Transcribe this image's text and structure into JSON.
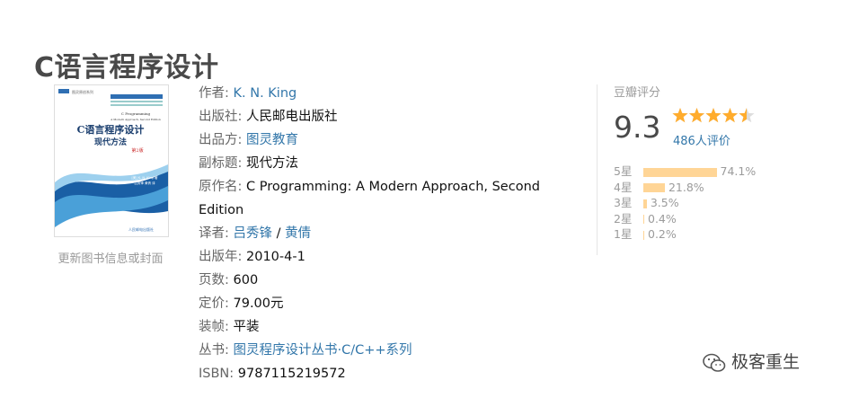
{
  "book": {
    "title": "C语言程序设计"
  },
  "cover": {
    "update_link": "更新图书信息或封面",
    "series_badge": "图灵原创系列",
    "title_cn": "C语言程序设计",
    "subtitle_cn": "现代方法",
    "edition": "第2版",
    "title_en_1": "C Programming",
    "title_en_2": "A Modern Approach, Second Edition",
    "author": "[美] K. N. King 著",
    "translators": "吕秀锋 黄倩 译",
    "publisher": "人民邮电出版社"
  },
  "info": [
    {
      "label": "作者:",
      "value": "K. N. King",
      "link": true
    },
    {
      "label": "出版社:",
      "value": "人民邮电出版社",
      "link": false
    },
    {
      "label": "出品方:",
      "value": "图灵教育",
      "link": true
    },
    {
      "label": "副标题:",
      "value": "现代方法",
      "link": false
    },
    {
      "label": "原作名:",
      "value": "C Programming: A Modern Approach, Second Edition",
      "link": false
    },
    {
      "label": "译者:",
      "value": "吕秀锋",
      "value2": "黄倩",
      "link": true
    },
    {
      "label": "出版年:",
      "value": "2010-4-1",
      "link": false
    },
    {
      "label": "页数:",
      "value": "600",
      "link": false
    },
    {
      "label": "定价:",
      "value": "79.00元",
      "link": false
    },
    {
      "label": "装帧:",
      "value": "平装",
      "link": false
    },
    {
      "label": "丛书:",
      "value": "图灵程序设计丛书·C/C++系列",
      "link": true
    },
    {
      "label": "ISBN:",
      "value": "9787115219572",
      "link": false
    }
  ],
  "rating": {
    "header": "豆瓣评分",
    "score": "9.3",
    "stars": 4.5,
    "count": "486人评价",
    "star_color": "#ffac2d",
    "distribution": [
      {
        "label": "5星",
        "percent": 74.1,
        "text": "74.1%"
      },
      {
        "label": "4星",
        "percent": 21.8,
        "text": "21.8%"
      },
      {
        "label": "3星",
        "percent": 3.5,
        "text": "3.5%"
      },
      {
        "label": "2星",
        "percent": 0.4,
        "text": "0.4%"
      },
      {
        "label": "1星",
        "percent": 0.2,
        "text": "0.2%"
      }
    ]
  },
  "watermark": {
    "text": "极客重生",
    "icon": "wechat-icon"
  },
  "colors": {
    "link": "#3377aa",
    "bar": "#ffd596",
    "title": "#494949"
  }
}
